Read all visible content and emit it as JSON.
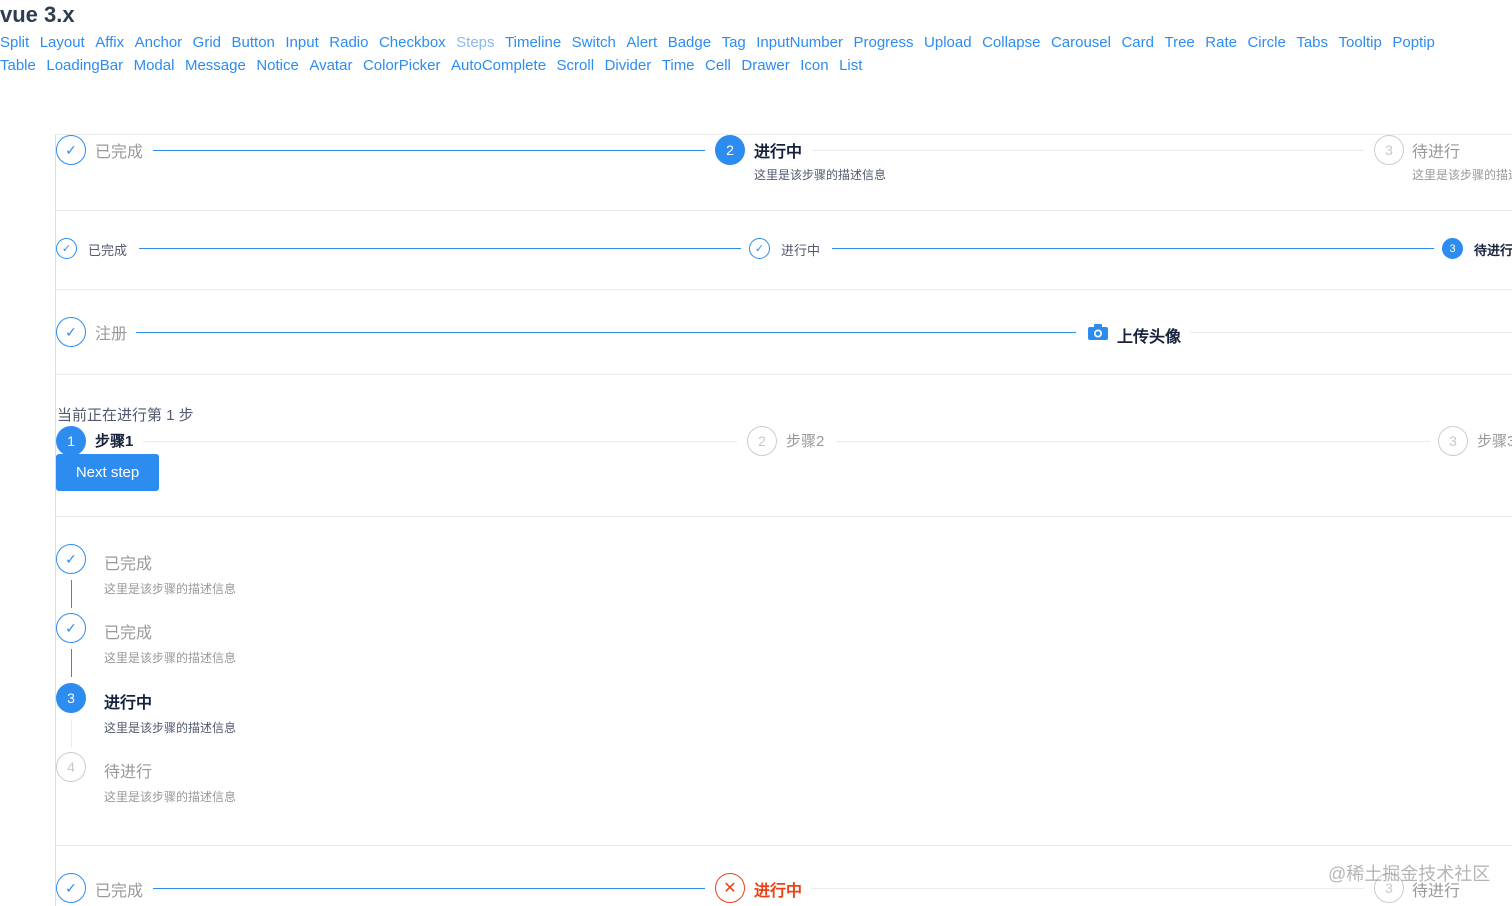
{
  "header": {
    "title": "vue 3.x"
  },
  "nav": {
    "row1": [
      "Split",
      "Layout",
      "Affix",
      "Anchor",
      "Grid",
      "Button",
      "Input",
      "Radio",
      "Checkbox",
      "Steps",
      "Timeline",
      "Switch",
      "Alert",
      "Badge",
      "Tag",
      "InputNumber",
      "Progress",
      "Upload",
      "Collapse",
      "Carousel",
      "Card",
      "Tree",
      "Rate",
      "Circle",
      "Tabs",
      "Tooltip",
      "Poptip"
    ],
    "row2": [
      "Table",
      "LoadingBar",
      "Modal",
      "Message",
      "Notice",
      "Avatar",
      "ColorPicker",
      "AutoComplete",
      "Scroll",
      "Divider",
      "Time",
      "Cell",
      "Drawer",
      "Icon",
      "List"
    ],
    "active": "Steps"
  },
  "demo1": {
    "steps": [
      {
        "title": "已完成",
        "status": "finish",
        "desc": ""
      },
      {
        "title": "进行中",
        "status": "process",
        "num": "2",
        "desc": "这里是该步骤的描述信息"
      },
      {
        "title": "待进行",
        "status": "wait",
        "num": "3",
        "desc": "这里是该步骤的描述信息"
      }
    ]
  },
  "demo2": {
    "steps": [
      {
        "title": "已完成",
        "status": "finish"
      },
      {
        "title": "进行中",
        "status": "finish"
      },
      {
        "title": "待进行",
        "status": "process",
        "num": "3"
      }
    ]
  },
  "demo3": {
    "steps": [
      {
        "title": "注册",
        "status": "finish"
      },
      {
        "title": "上传头像",
        "status": "process",
        "icon": "camera-icon"
      }
    ]
  },
  "demo4": {
    "current_text": "当前正在进行第 1 步",
    "steps": [
      {
        "title": "步骤1",
        "status": "process",
        "num": "1"
      },
      {
        "title": "步骤2",
        "status": "wait",
        "num": "2"
      },
      {
        "title": "步骤3",
        "status": "wait",
        "num": "3"
      }
    ],
    "button_label": "Next step"
  },
  "demo5": {
    "steps": [
      {
        "title": "已完成",
        "status": "finish",
        "desc": "这里是该步骤的描述信息"
      },
      {
        "title": "已完成",
        "status": "finish",
        "desc": "这里是该步骤的描述信息"
      },
      {
        "title": "进行中",
        "status": "process",
        "num": "3",
        "desc": "这里是该步骤的描述信息"
      },
      {
        "title": "待进行",
        "status": "wait",
        "num": "4",
        "desc": "这里是该步骤的描述信息"
      }
    ]
  },
  "demo6": {
    "steps": [
      {
        "title": "已完成",
        "status": "finish"
      },
      {
        "title": "进行中",
        "status": "error"
      },
      {
        "title": "待进行",
        "status": "wait",
        "num": "3"
      }
    ]
  },
  "watermark": "@稀土掘金技术社区",
  "colors": {
    "primary": "#2d8cf0",
    "error": "#ed4014",
    "wait": "#c5c8ce",
    "text": "#515a6e"
  }
}
